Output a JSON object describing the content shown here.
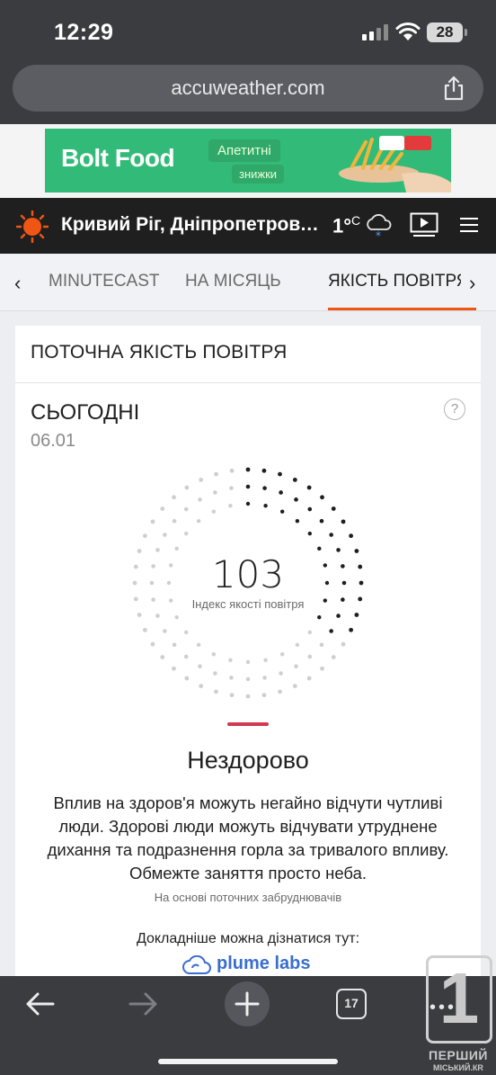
{
  "status_bar": {
    "time": "12:29",
    "battery": "28"
  },
  "browser": {
    "url": "accuweather.com"
  },
  "ad": {
    "brand": "Bolt Food",
    "tag1": "Апетитні",
    "tag2": "знижки"
  },
  "header": {
    "location": "Кривий Ріг, Дніпропетровська",
    "temperature": "1°",
    "unit": "C"
  },
  "tabs": {
    "items": [
      "MINUTECAST",
      "НА МІСЯЦЬ",
      "ЯКІСТЬ ПОВІТРЯ"
    ],
    "active_index": 2
  },
  "card": {
    "title": "ПОТОЧНА ЯКІСТЬ ПОВІТРЯ",
    "day_label": "СЬОГОДНІ",
    "date": "06.01",
    "help": "?",
    "aqi_value": "103",
    "aqi_label": "Індекс якості повітря",
    "aqi_fraction": 0.34,
    "status": "Нездорово",
    "status_color": "#d03a51",
    "description": "Вплив на здоров'я можуть негайно відчути чутливі люди. Здорові люди можуть відчувати утруднене дихання та подразнення горла за тривалого впливу. Обмежте заняття просто неба.",
    "basis": "На основі поточних забруднювачів",
    "more_info": "Докладніше можна дізнатися тут:",
    "partner": "plume labs"
  },
  "toolbar": {
    "tabs_count": "17"
  },
  "watermark": {
    "digit": "1",
    "line1": "ПЕРШИЙ",
    "line2": "МІСЬКИЙ.КR"
  },
  "colors": {
    "accent": "#f05514",
    "dark_header": "#1f1f1f",
    "active_dot": "#1f1f1f",
    "inactive_dot": "#cfcfcf",
    "link": "#3a6ecf"
  }
}
